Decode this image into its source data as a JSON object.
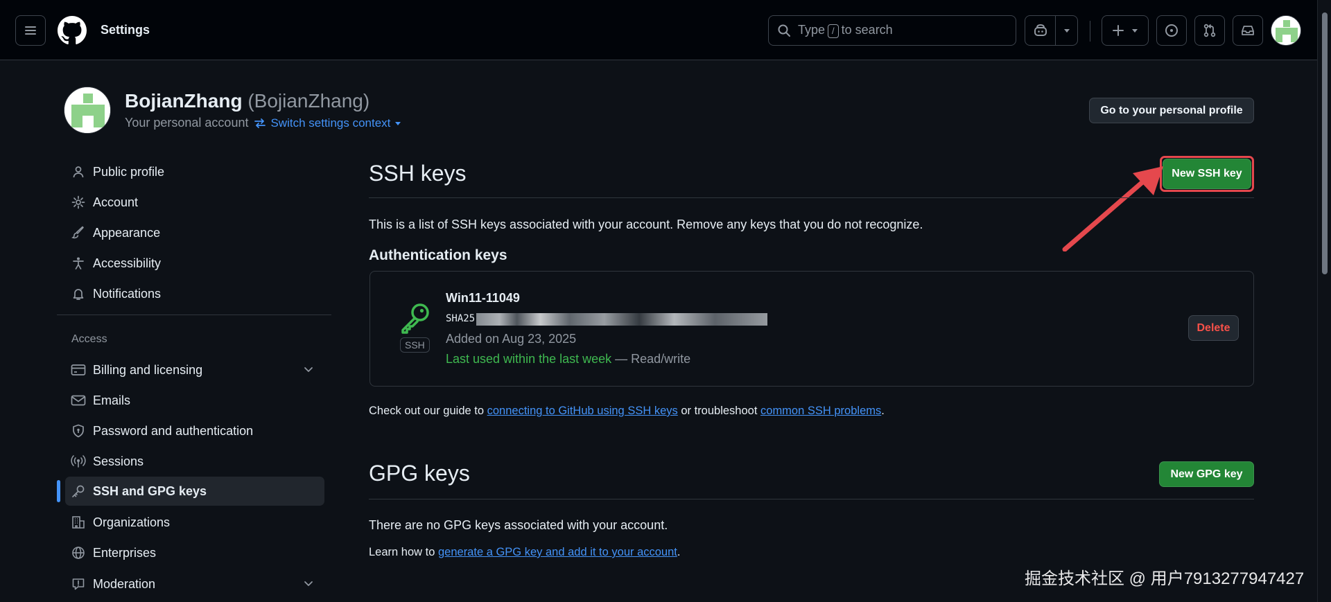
{
  "header": {
    "title": "Settings",
    "search_prefix": "Type",
    "search_key": "/",
    "search_suffix": "to search"
  },
  "account": {
    "name": "BojianZhang",
    "login": "(BojianZhang)",
    "subtitle": "Your personal account",
    "switch_context": "Switch settings context",
    "go_to_profile": "Go to your personal profile"
  },
  "sidebar": {
    "items": [
      {
        "label": "Public profile",
        "icon": "person-icon"
      },
      {
        "label": "Account",
        "icon": "gear-icon"
      },
      {
        "label": "Appearance",
        "icon": "paintbrush-icon"
      },
      {
        "label": "Accessibility",
        "icon": "accessibility-icon"
      },
      {
        "label": "Notifications",
        "icon": "bell-icon"
      }
    ],
    "access_heading": "Access",
    "access_items": [
      {
        "label": "Billing and licensing",
        "icon": "credit-card-icon"
      },
      {
        "label": "Emails",
        "icon": "mail-icon"
      },
      {
        "label": "Password and authentication",
        "icon": "shield-lock-icon"
      },
      {
        "label": "Sessions",
        "icon": "broadcast-icon"
      },
      {
        "label": "SSH and GPG keys",
        "icon": "key-icon"
      },
      {
        "label": "Organizations",
        "icon": "organization-icon"
      },
      {
        "label": "Enterprises",
        "icon": "globe-icon"
      },
      {
        "label": "Moderation",
        "icon": "report-icon"
      }
    ]
  },
  "ssh": {
    "title": "SSH keys",
    "new_button": "New SSH key",
    "description": "This is a list of SSH keys associated with your account. Remove any keys that you do not recognize.",
    "auth_heading": "Authentication keys",
    "key": {
      "title": "Win11-11049",
      "fingerprint_prefix": "SHA25",
      "badge": "SSH",
      "added": "Added on Aug 23, 2025",
      "last_used": "Last used within the last week",
      "access": " — Read/write",
      "delete_label": "Delete"
    },
    "guide_prefix": "Check out our guide to ",
    "guide_link1": "connecting to GitHub using SSH keys",
    "guide_middle": " or troubleshoot ",
    "guide_link2": "common SSH problems",
    "guide_suffix": "."
  },
  "gpg": {
    "title": "GPG keys",
    "new_button": "New GPG key",
    "empty": "There are no GPG keys associated with your account.",
    "learn_prefix": "Learn how to ",
    "learn_link": "generate a GPG key and add it to your account",
    "learn_suffix": "."
  },
  "watermark": "掘金技术社区 @ 用户7913277947427",
  "colors": {
    "background": "#0d1117",
    "header_bg": "#010409",
    "accent_blue": "#4493f8",
    "green_button": "#238636",
    "danger": "#f85149",
    "annotation_red": "#e5484d"
  }
}
